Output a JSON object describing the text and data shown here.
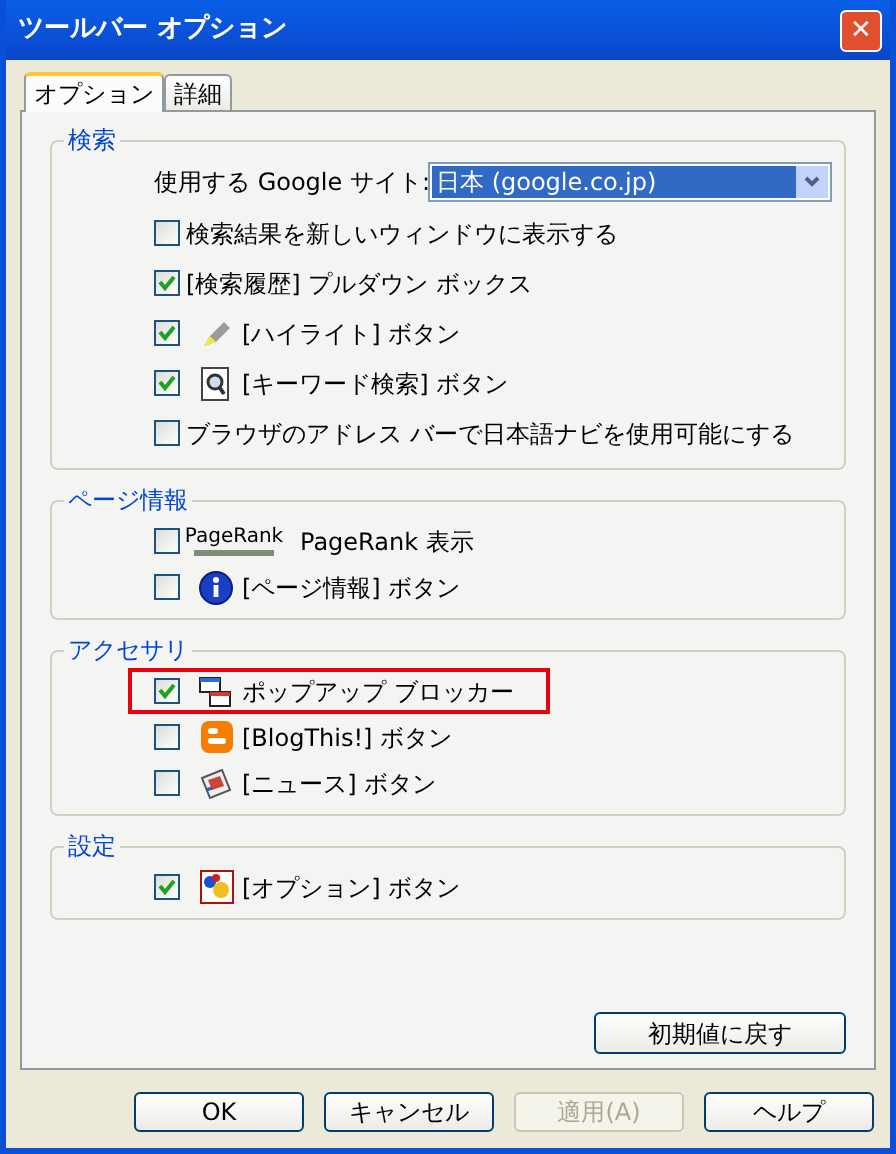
{
  "window": {
    "title": "ツールバー オプション",
    "close": "✕"
  },
  "tabs": [
    {
      "label": "オプション",
      "selected": true
    },
    {
      "label": "詳細",
      "selected": false
    }
  ],
  "groups": [
    {
      "title": "検索",
      "site": {
        "label": "使用する Google サイト:",
        "value": "日本 (google.co.jp)"
      },
      "items": [
        {
          "kind": "plain",
          "label": "検索結果を新しいウィンドウに表示する",
          "checked": false,
          "highlighted": false
        },
        {
          "kind": "plain",
          "label": "[検索履歴] プルダウン ボックス",
          "checked": true,
          "highlighted": false
        },
        {
          "kind": "highlighter",
          "label": "[ハイライト] ボタン",
          "checked": true,
          "highlighted": false
        },
        {
          "kind": "find",
          "label": "[キーワード検索] ボタン",
          "checked": true,
          "highlighted": false
        },
        {
          "kind": "plain",
          "label": "ブラウザのアドレス バーで日本語ナビを使用可能にする",
          "checked": false,
          "highlighted": false
        }
      ]
    },
    {
      "title": "ページ情報",
      "items": [
        {
          "kind": "pagerank",
          "badge": "PageRank",
          "label": "PageRank 表示",
          "checked": false,
          "highlighted": false
        },
        {
          "kind": "info",
          "label": "[ページ情報] ボタン",
          "checked": false,
          "highlighted": false
        }
      ]
    },
    {
      "title": "アクセサリ",
      "items": [
        {
          "kind": "popup",
          "label": "ポップアップ ブロッカー",
          "checked": true,
          "highlighted": true
        },
        {
          "kind": "blog",
          "label": "[BlogThis!] ボタン",
          "checked": false,
          "highlighted": false
        },
        {
          "kind": "news",
          "label": "[ニュース] ボタン",
          "checked": false,
          "highlighted": false
        }
      ]
    },
    {
      "title": "設定",
      "items": [
        {
          "kind": "options",
          "label": "[オプション] ボタン",
          "checked": true,
          "highlighted": false
        }
      ]
    }
  ],
  "reset_button": "初期値に戻す",
  "buttons": [
    {
      "label": "OK",
      "disabled": false
    },
    {
      "label": "キャンセル",
      "disabled": false
    },
    {
      "label": "適用(A)",
      "disabled": true
    },
    {
      "label": "ヘルプ",
      "disabled": false
    }
  ]
}
